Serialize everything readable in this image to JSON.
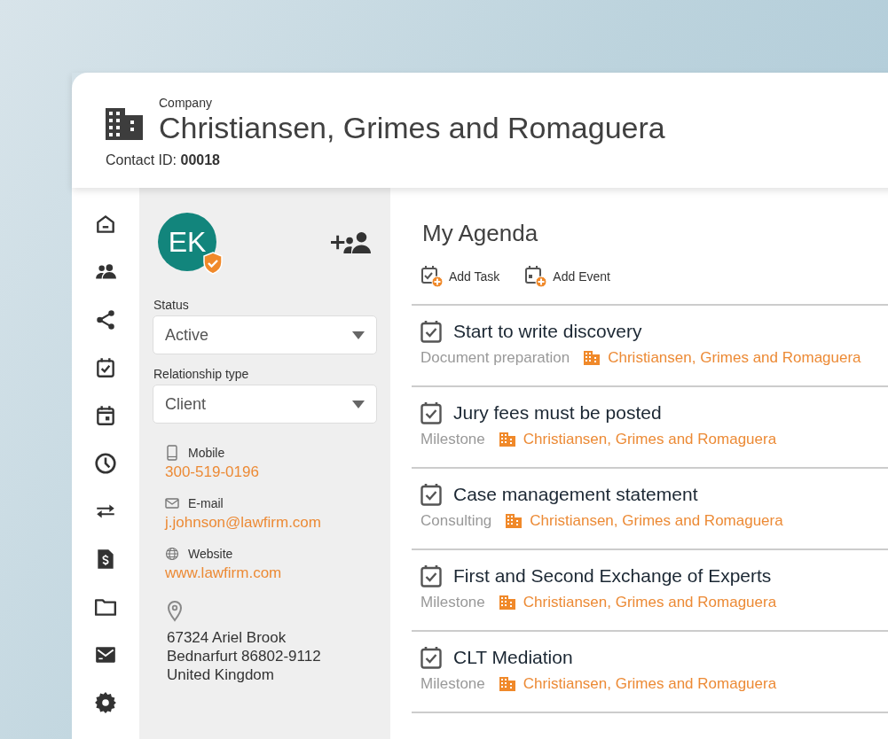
{
  "header": {
    "kicker": "Company",
    "title": "Christiansen, Grimes and Romaguera",
    "contact_id_label": "Contact ID:",
    "contact_id": "00018"
  },
  "contact": {
    "initials": "EK",
    "verified": true,
    "fields": [
      {
        "label": "Status",
        "value": "Active"
      },
      {
        "label": "Relationship type",
        "value": "Client"
      }
    ],
    "details": [
      {
        "kind": "phone",
        "label": "Mobile",
        "value": "300-519-0196"
      },
      {
        "kind": "email",
        "label": "E-mail",
        "value": "j.johnson@lawfirm.com"
      },
      {
        "kind": "web",
        "label": "Website",
        "value": "www.lawfirm.com"
      }
    ],
    "address": [
      "67324 Ariel Brook",
      "Bednarfurt 86802-9112",
      "United Kingdom"
    ]
  },
  "agenda": {
    "title": "My Agenda",
    "actions": [
      {
        "kind": "task",
        "label": "Add Task"
      },
      {
        "kind": "event",
        "label": "Add Event"
      }
    ],
    "items": [
      {
        "title": "Start to write discovery",
        "category": "Document preparation",
        "company": "Christiansen, Grimes and Romaguera"
      },
      {
        "title": "Jury fees must be posted",
        "category": "Milestone",
        "company": "Christiansen, Grimes and Romaguera"
      },
      {
        "title": "Case management statement",
        "category": "Consulting",
        "company": "Christiansen, Grimes and Romaguera"
      },
      {
        "title": "First and Second Exchange of Experts",
        "category": "Milestone",
        "company": "Christiansen, Grimes and Romaguera"
      },
      {
        "title": "CLT Mediation",
        "category": "Milestone",
        "company": "Christiansen, Grimes and Romaguera"
      }
    ]
  }
}
